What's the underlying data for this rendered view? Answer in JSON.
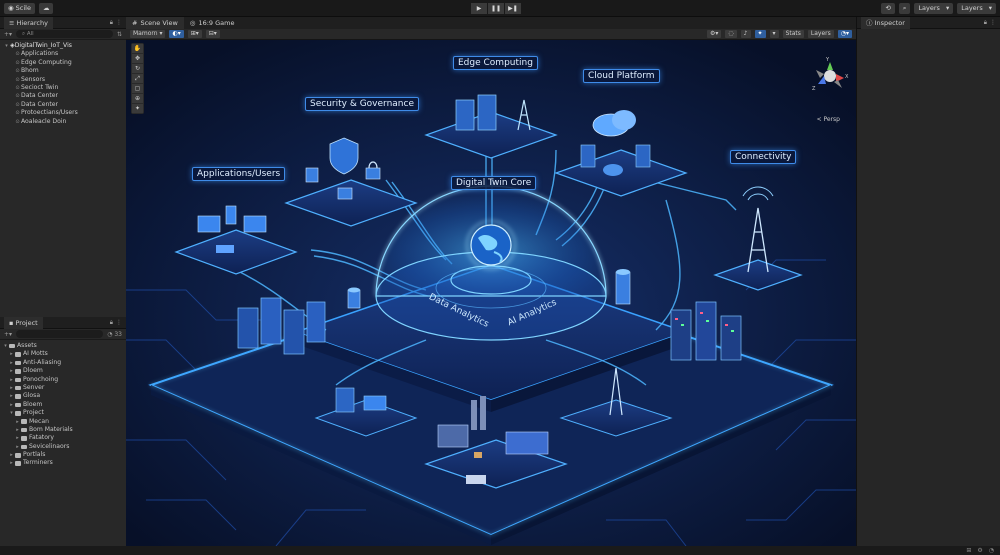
{
  "toolbar": {
    "account_label": "Scile",
    "cloud_icon": "cloud-icon",
    "play_glyphs": [
      "▶",
      "❚❚",
      "▶❚"
    ],
    "layers_labels": [
      "Layers",
      "Layers"
    ],
    "search_icon": "search-icon",
    "history_icon": "history-icon"
  },
  "hierarchy": {
    "title": "Hierarchy",
    "search_placeholder": "All",
    "root": "DigitalTwin_IoT_Vis",
    "items": [
      "Applications",
      "Edge Computing",
      "Bhom",
      "Sensors",
      "Secioct Twin",
      "Data Center",
      "Data Center",
      "Protoectians/Users",
      "Aoaleacle Doin"
    ]
  },
  "project": {
    "title": "Project",
    "count": "33",
    "assets_label": "Assets",
    "items": [
      "AI Motts",
      "Anti-Aliasing",
      "Dloem",
      "Ponochoing",
      "Senver",
      "Glosa",
      "Bloem",
      "Project"
    ],
    "subitems": [
      "Mecan",
      "Bom Materials",
      "Fatatory",
      "Sevicelinaors"
    ],
    "after": [
      "Portlals",
      "Terminers"
    ]
  },
  "scene": {
    "tabs": [
      "Scene View",
      "16:9 Game"
    ],
    "shading_mode": "Mamorn",
    "stats_label": "Stats",
    "layers_label": "Layers",
    "persp_label": "< Persp",
    "gizmo_axes": [
      "Y",
      "X",
      "Z"
    ],
    "labels": {
      "edge": "Edge Computing",
      "cloud": "Cloud Platform",
      "security": "Security & Governance",
      "connectivity": "Connectivity",
      "applications": "Applications/Users",
      "core": "Digital Twin Core",
      "data_analytics": "Data Analytics",
      "ai_analytics": "AI Analytics"
    },
    "accent_color": "#3f8be8"
  },
  "inspector": {
    "title": "Inspector"
  }
}
